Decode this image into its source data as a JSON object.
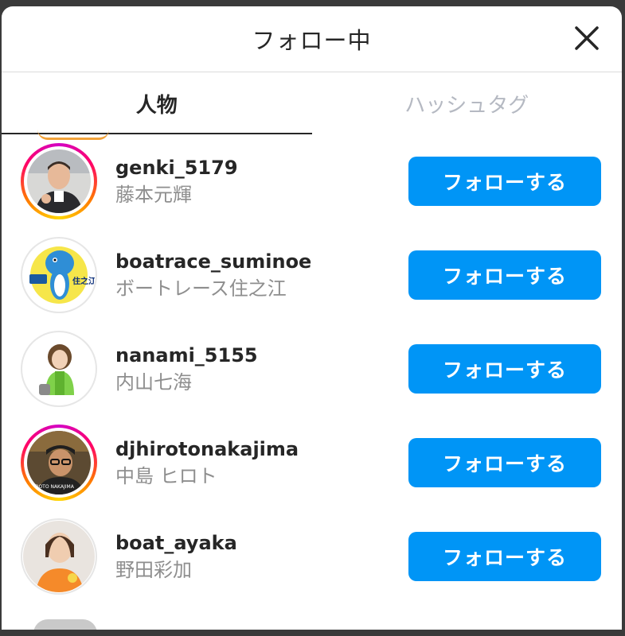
{
  "header": {
    "title": "フォロー中",
    "close_icon": "close-icon"
  },
  "tabs": [
    {
      "label": "人物",
      "active": true
    },
    {
      "label": "ハッシュタグ",
      "active": false
    }
  ],
  "following": [
    {
      "username": "genki_5179",
      "full_name": "藤本元輝",
      "button": "フォローする",
      "story_ring": true
    },
    {
      "username": "boatrace_suminoe",
      "full_name": "ボートレース住之江",
      "button": "フォローする",
      "story_ring": false
    },
    {
      "username": "nanami_5155",
      "full_name": "内山七海",
      "button": "フォローする",
      "story_ring": false
    },
    {
      "username": "djhirotonakajima",
      "full_name": "中島 ヒロト",
      "button": "フォローする",
      "story_ring": true
    },
    {
      "username": "boat_ayaka",
      "full_name": "野田彩加",
      "button": "フォローする",
      "story_ring": false
    }
  ],
  "colors": {
    "follow_button": "#0095f6",
    "story_ring": "#d300c5"
  },
  "avatar_texts": {
    "boatrace_logo": "住之江",
    "dj_caption": "HIROTO NAKAJIMA"
  }
}
